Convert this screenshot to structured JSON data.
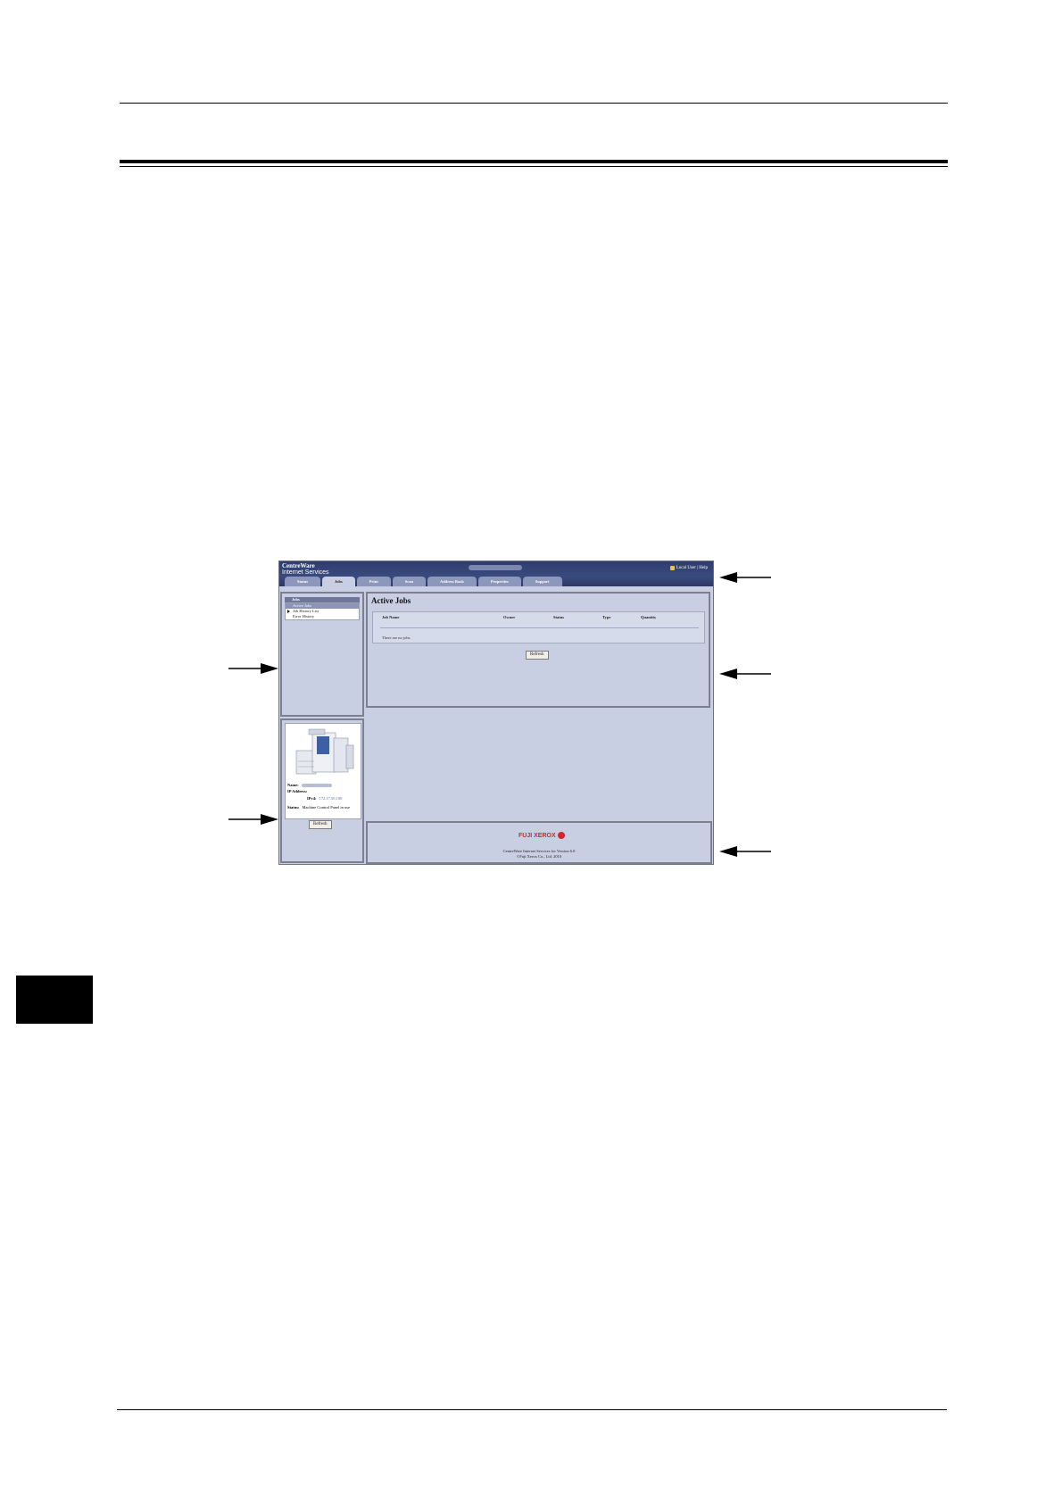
{
  "page": {
    "color_rule": "#000000",
    "chapter_tab_color": "#000000"
  },
  "screenshot": {
    "banner": {
      "brand_line1": "CentreWare",
      "brand_line2": "Internet Services",
      "user_links": "Local User | Help",
      "lock_icon": "lock-icon"
    },
    "tabs": [
      {
        "label": "Status"
      },
      {
        "label": "Jobs"
      },
      {
        "label": "Print"
      },
      {
        "label": "Scan"
      },
      {
        "label": "Address Book"
      },
      {
        "label": "Properties"
      },
      {
        "label": "Support"
      }
    ],
    "active_tab": "Jobs",
    "nav": {
      "header": "Jobs",
      "items": [
        {
          "label": "Active Jobs"
        },
        {
          "label": "Job History List"
        },
        {
          "label": "Error History"
        }
      ]
    },
    "device": {
      "name_label": "Name:",
      "ip_label": "IP Address:",
      "ipv4_label": "IPv4:",
      "ipv4_value": "172.17.50.100",
      "status_label": "Status:",
      "status_value": "Machine Control Panel in use",
      "refresh_label": "Refresh"
    },
    "main": {
      "title": "Active Jobs",
      "columns": [
        "Job Name",
        "Owner",
        "Status",
        "Type",
        "Quantity"
      ],
      "empty_message": "There are no jobs.",
      "refresh_label": "Refresh"
    },
    "footer": {
      "logo_text": "FUJI XEROX",
      "line1": "CentreWare Internet Services for                 Version 6.0",
      "line2": "©Fuji Xerox Co., Ltd. 2010"
    },
    "colors": {
      "banner": "#2f3d6e",
      "panel_bg": "#c9cfe3",
      "logo_red": "#d6252d"
    }
  }
}
